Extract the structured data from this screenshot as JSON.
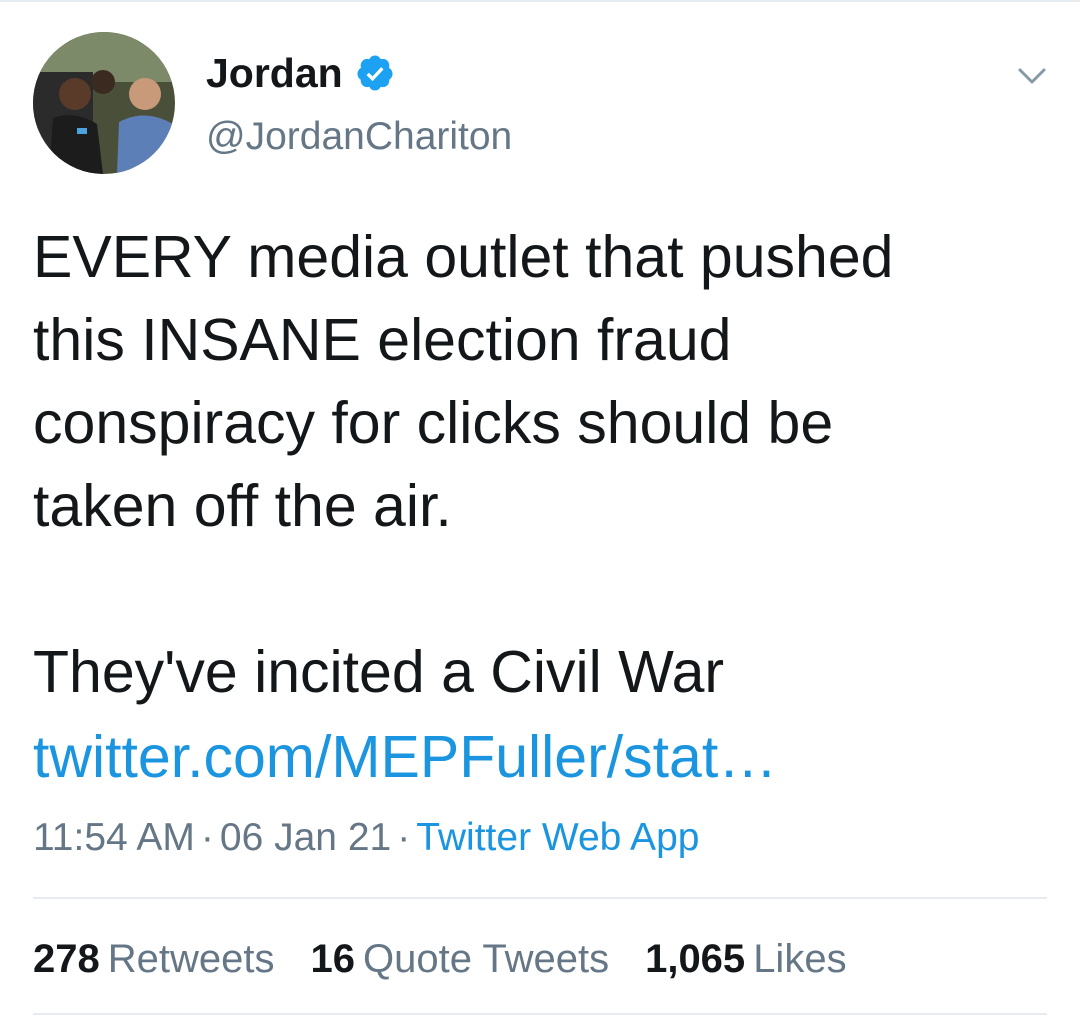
{
  "author": {
    "display_name": "Jordan",
    "handle": "@JordanChariton",
    "verified": true,
    "avatar_icon": "profile-photo"
  },
  "tweet": {
    "text": "EVERY media outlet that pushed\nthis INSANE election fraud\nconspiracy for clicks should be\ntaken off the air.\n\nThey've incited a Civil War",
    "link": "twitter.com/MEPFuller/stat…",
    "time": "11:54 AM",
    "date": "06 Jan 21",
    "separator": "·",
    "source": "Twitter Web App"
  },
  "stats": [
    {
      "count": "278",
      "label": "Retweets"
    },
    {
      "count": "16",
      "label": "Quote Tweets"
    },
    {
      "count": "1,065",
      "label": "Likes"
    }
  ],
  "icons": {
    "verified": "verified-badge-icon",
    "menu": "chevron-down-icon"
  },
  "colors": {
    "accent": "#1b95e0",
    "verified_badge": "#1da1f2",
    "secondary_text": "#657786",
    "primary_text": "#14171a",
    "divider": "#e6ecf0"
  }
}
